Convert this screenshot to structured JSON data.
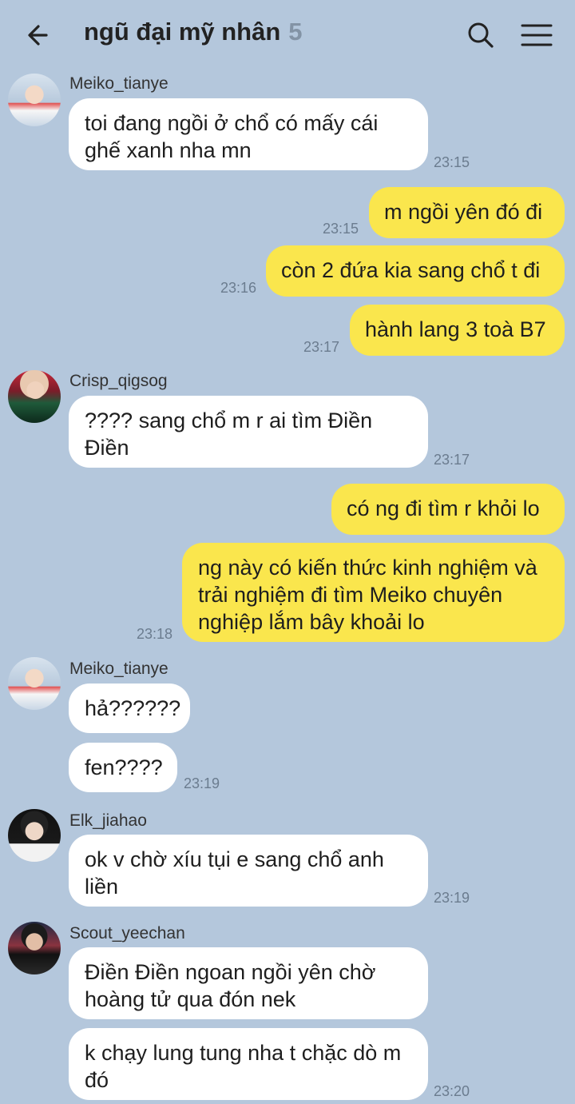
{
  "header": {
    "title": "ngũ đại mỹ nhân",
    "member_count": "5"
  },
  "messages": [
    {
      "sender": "Meiko_tianye",
      "text": "toi đang ngồi ở chổ có mấy cái ghế xanh nha mn",
      "time": "23:15"
    },
    {
      "text": "m ngồi yên đó đi",
      "time": "23:15"
    },
    {
      "text": "còn 2 đứa kia sang chổ t đi",
      "time": "23:16"
    },
    {
      "text": "hành lang 3 toà B7",
      "time": "23:17"
    },
    {
      "sender": "Crisp_qigsog",
      "text": "???? sang chổ m r ai tìm Điền Điền",
      "time": "23:17"
    },
    {
      "text": "có ng đi tìm r khỏi lo"
    },
    {
      "text": "ng này có kiến thức kinh nghiệm và trải nghiệm đi tìm Meiko chuyên nghiệp lắm bây khoải lo",
      "time": "23:18"
    },
    {
      "sender": "Meiko_tianye",
      "text": "hả??????"
    },
    {
      "text": "fen????",
      "time": "23:19"
    },
    {
      "sender": "Elk_jiahao",
      "text": "ok v chờ xíu tụi e sang chổ anh liền",
      "time": "23:19"
    },
    {
      "sender": "Scout_yeechan",
      "text": "Điền Điền ngoan ngồi yên chờ hoàng tử qua đón nek"
    },
    {
      "text": "k chạy lung tung nha t chặc dò m đó",
      "time": "23:20"
    }
  ]
}
